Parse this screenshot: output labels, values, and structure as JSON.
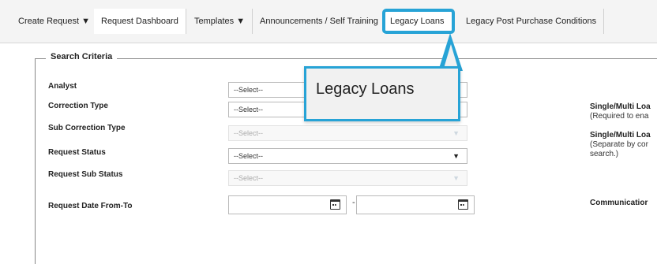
{
  "nav": {
    "items": [
      {
        "label": "Create Request ▼"
      },
      {
        "label": "Request Dashboard"
      },
      {
        "label": "Templates ▼"
      },
      {
        "label": "Announcements / Self Training"
      },
      {
        "label": "Legacy Loans"
      },
      {
        "label": "Legacy Post Purchase Conditions"
      }
    ]
  },
  "search": {
    "legend": "Search Criteria",
    "analyst_label": "Analyst",
    "analyst_value": "--Select--",
    "correction_type_label": "Correction Type",
    "correction_type_value": "--Select--",
    "sub_correction_type_label": "Sub Correction Type",
    "sub_correction_type_value": "--Select--",
    "request_status_label": "Request Status",
    "request_status_value": "--Select--",
    "request_sub_status_label": "Request Sub Status",
    "request_sub_status_value": "--Select--",
    "request_date_label": "Request Date From-To",
    "date_separator": "-"
  },
  "right_panel": {
    "single_multi_label_1": "Single/Multi Loa",
    "single_multi_note_1": "(Required to ena",
    "single_multi_label_2": "Single/Multi Loa",
    "single_multi_note_2a": "(Separate by cor",
    "single_multi_note_2b": "search.)",
    "communication_label": "Communicatior"
  },
  "callout": {
    "text": "Legacy Loans",
    "color": "#27a3d6"
  }
}
